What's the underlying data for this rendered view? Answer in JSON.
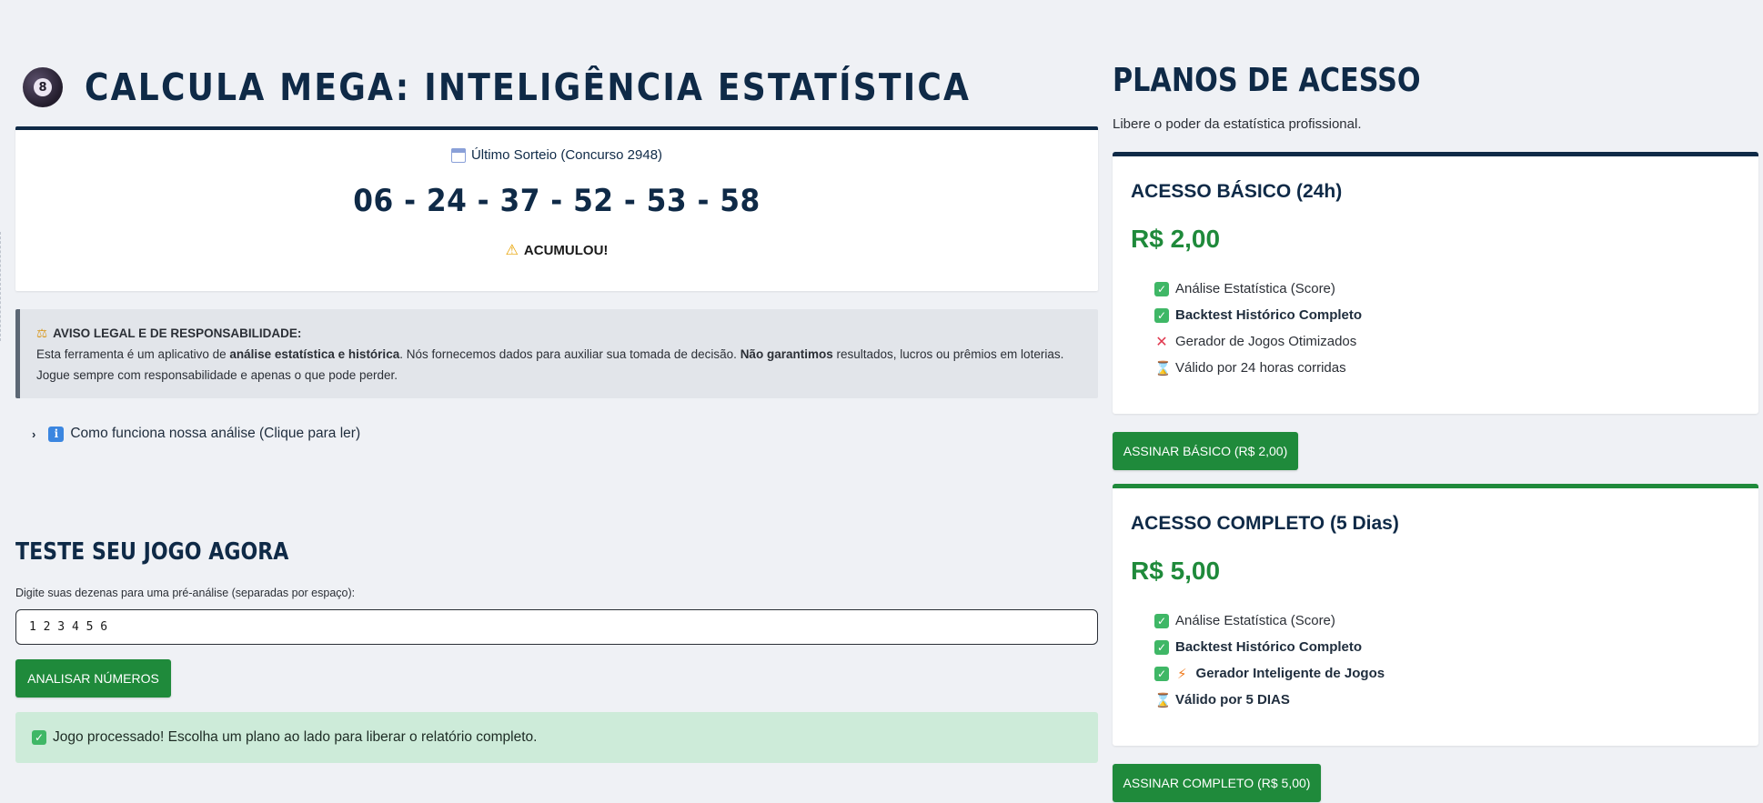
{
  "header": {
    "logo_glyph": "8",
    "title": "CALCULA MEGA: INTELIGÊNCIA ESTATÍSTICA"
  },
  "last_draw": {
    "heading": "Último Sorteio (Concurso 2948)",
    "numbers": "06 - 24 - 37 - 52 - 53 - 58",
    "status": "ACUMULOU!"
  },
  "legal": {
    "title": "AVISO LEGAL E DE RESPONSABILIDADE:",
    "text_1": "Esta ferramenta é um aplicativo de ",
    "text_bold_1": "análise estatística e histórica",
    "text_2": ". Nós fornecemos dados para auxiliar sua tomada de decisão. ",
    "text_bold_2": "Não garantimos",
    "text_3": " resultados, lucros ou prêmios em loterias. Jogue sempre com responsabilidade e apenas o que pode perder."
  },
  "expander": {
    "label": "Como funciona nossa análise (Clique para ler)"
  },
  "test": {
    "title": "TESTE SEU JOGO AGORA",
    "input_label": "Digite suas dezenas para uma pré-análise (separadas por espaço):",
    "input_value": "1 2 3 4 5 6",
    "button_label": "ANALISAR NÚMEROS",
    "success_message": "Jogo processado! Escolha um plano ao lado para liberar o relatório completo."
  },
  "plans": {
    "title": "PLANOS DE ACESSO",
    "subtitle": "Libere o poder da estatística profissional.",
    "basic": {
      "name": "ACESSO BÁSICO (24h)",
      "price": "R$ 2,00",
      "features": [
        {
          "label": "Análise Estatística (Score)",
          "icon": "check-icon",
          "bold": false
        },
        {
          "label": "Backtest Histórico Completo",
          "icon": "check-icon",
          "bold": true
        },
        {
          "label": "Gerador de Jogos Otimizados",
          "icon": "cross-icon",
          "bold": false
        },
        {
          "label": "Válido por 24 horas corridas",
          "icon": "hourglass-icon",
          "bold": false
        }
      ],
      "button_label": "ASSINAR BÁSICO (R$ 2,00)"
    },
    "full": {
      "name": "ACESSO COMPLETO (5 Dias)",
      "price": "R$ 5,00",
      "features": [
        {
          "label": "Análise Estatística (Score)",
          "icon": "check-icon",
          "bold": false
        },
        {
          "label": "Backtest Histórico Completo",
          "icon": "check-icon",
          "bold": true
        },
        {
          "label": "Gerador Inteligente de Jogos",
          "icon": "check-bolt-icon",
          "bold": true
        },
        {
          "label": "Válido por 5 DIAS",
          "icon": "hourglass-icon",
          "bold": true
        }
      ],
      "button_label": "ASSINAR COMPLETO (R$ 5,00)"
    }
  },
  "colors": {
    "background": "#eff1f5",
    "navy": "#0f2a47",
    "green": "#1f8a3b",
    "success_bg": "#cdebd9"
  }
}
